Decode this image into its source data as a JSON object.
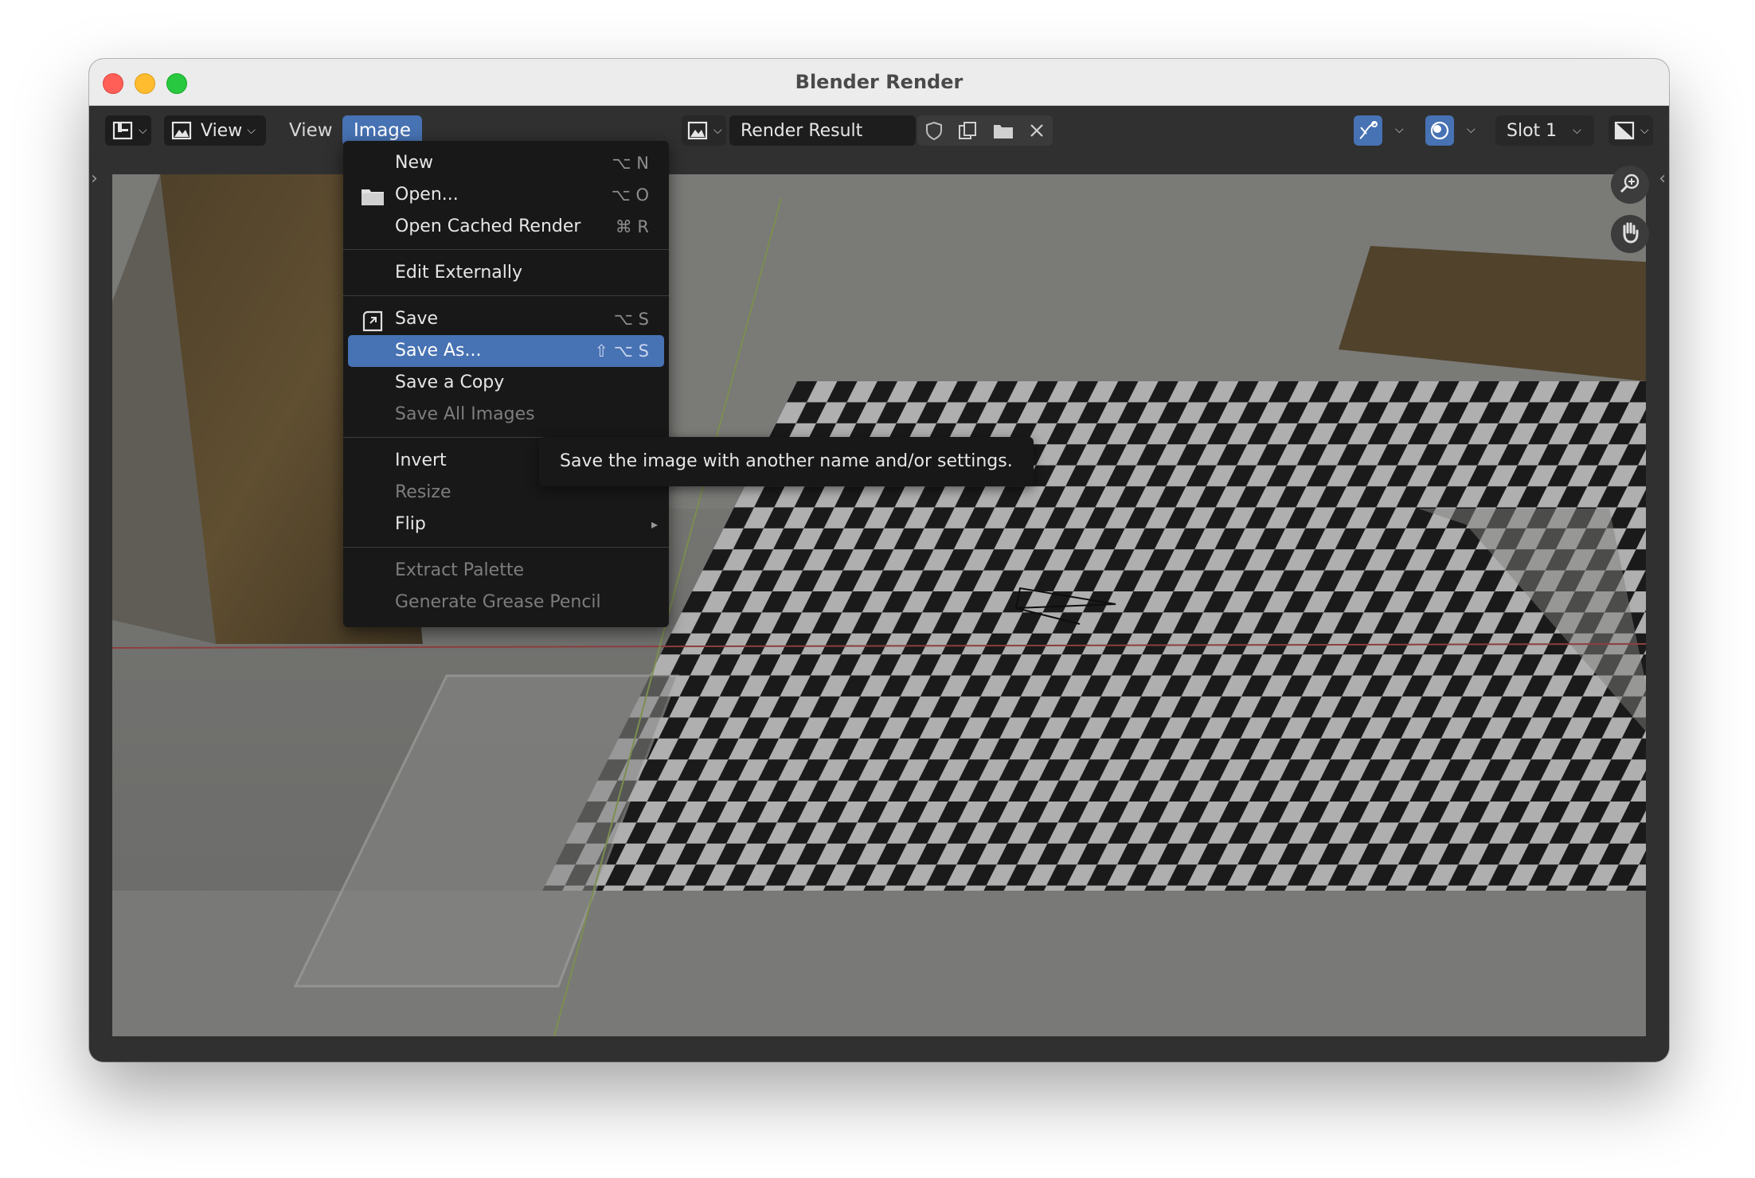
{
  "window": {
    "title": "Blender Render"
  },
  "header": {
    "view_dropdown_label": "View",
    "view_menu": "View",
    "image_menu": "Image",
    "image_name": "Render Result",
    "slot_label": "Slot 1"
  },
  "image_menu": {
    "items": [
      {
        "label": "New",
        "shortcut": "⌥ N"
      },
      {
        "label": "Open...",
        "shortcut": "⌥ O"
      },
      {
        "label": "Open Cached Render",
        "shortcut": "⌘ R"
      },
      {
        "label": "Edit Externally",
        "shortcut": ""
      },
      {
        "label": "Save",
        "shortcut": "⌥ S"
      },
      {
        "label": "Save As...",
        "shortcut": "⇧ ⌥ S"
      },
      {
        "label": "Save a Copy",
        "shortcut": ""
      },
      {
        "label": "Save All Images",
        "shortcut": ""
      },
      {
        "label": "Invert",
        "shortcut": ""
      },
      {
        "label": "Resize",
        "shortcut": ""
      },
      {
        "label": "Flip",
        "shortcut": ""
      },
      {
        "label": "Extract Palette",
        "shortcut": ""
      },
      {
        "label": "Generate Grease Pencil",
        "shortcut": ""
      }
    ]
  },
  "tooltip": {
    "text": "Save the image with another name and/or settings."
  },
  "colors": {
    "accent": "#4772b3",
    "menu_bg": "#181818",
    "header_bg": "#303030"
  }
}
